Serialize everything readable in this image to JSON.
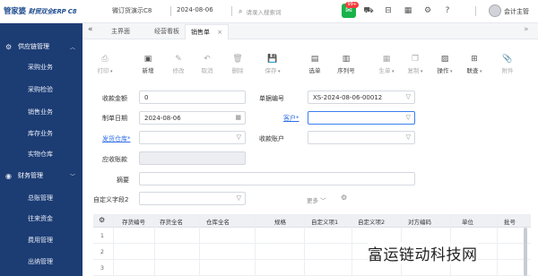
{
  "brand": {
    "name": "管家婆",
    "product": "财贸双全ERP C8"
  },
  "topbar": {
    "company": "微订货演示C8",
    "date": "2024-08-06",
    "search_placeholder": "请录入搜索词",
    "message_badge": "99+",
    "user": "会计主管"
  },
  "sidebar": {
    "groups": [
      {
        "label": "供应链管理",
        "icon": "chain-icon",
        "collapse": "︿"
      },
      {
        "label": "财务管理",
        "icon": "coin-icon",
        "collapse": "﹀"
      }
    ],
    "supply_items": [
      "采购业务",
      "采购检验",
      "销售业务",
      "库存业务",
      "实物仓库"
    ],
    "finance_items": [
      "总账管理",
      "往来资金",
      "费用管理",
      "出纳管理"
    ]
  },
  "tabs": {
    "collapse": "«",
    "items": [
      "主界面",
      "经营看板",
      "销售单"
    ],
    "close": "×",
    "expand": "»"
  },
  "toolbar": {
    "buttons": [
      {
        "label": "打印",
        "icon": "printer-icon",
        "glyph": "⎙",
        "disabled": true,
        "dropdown": true
      },
      {
        "label": "新增",
        "icon": "new-icon",
        "glyph": "▣",
        "disabled": false
      },
      {
        "label": "修改",
        "icon": "edit-icon",
        "glyph": "✎",
        "disabled": true
      },
      {
        "label": "取消",
        "icon": "undo-icon",
        "glyph": "↶",
        "disabled": true
      },
      {
        "label": "删除",
        "icon": "trash-icon",
        "glyph": "🗑",
        "disabled": true
      },
      {
        "label": "保存",
        "icon": "save-icon",
        "glyph": "💾",
        "disabled": true,
        "dropdown": true
      },
      {
        "label": "选单",
        "icon": "select-bill-icon",
        "glyph": "▤",
        "disabled": false
      },
      {
        "label": "序列号",
        "icon": "serial-icon",
        "glyph": "▥",
        "disabled": false
      },
      {
        "label": "生单",
        "icon": "generate-icon",
        "glyph": "▦",
        "disabled": true,
        "dropdown": true
      },
      {
        "label": "复制",
        "icon": "copy-icon",
        "glyph": "❐",
        "disabled": true,
        "dropdown": true
      },
      {
        "label": "操作",
        "icon": "operation-icon",
        "glyph": "▨",
        "disabled": false,
        "dropdown": true
      },
      {
        "label": "联查",
        "icon": "link-query-icon",
        "glyph": "⊞",
        "disabled": false,
        "dropdown": true
      },
      {
        "label": "附件",
        "icon": "attachment-icon",
        "glyph": "📎",
        "disabled": true
      }
    ]
  },
  "form": {
    "received_amount": {
      "label": "收款金额",
      "value": "0"
    },
    "bill_no": {
      "label": "单据编号",
      "value": "XS-2024-08-06-00012"
    },
    "bill_date": {
      "label": "制单日期",
      "value": "2024-08-06"
    },
    "customer": {
      "label": "客户*",
      "value": ""
    },
    "ship_warehouse": {
      "label": "发货仓库*",
      "value": ""
    },
    "receive_account": {
      "label": "收款账户",
      "value": ""
    },
    "receivable": {
      "label": "应收账款",
      "value": ""
    },
    "summary": {
      "label": "摘要",
      "value": ""
    },
    "custom_field2": {
      "label": "自定义字段2",
      "value": ""
    },
    "more": "更多 ﹀"
  },
  "grid": {
    "columns": [
      "存货编号",
      "存货全名",
      "仓库全名",
      "规格",
      "自定义项1",
      "自定义项2",
      "对方编码",
      "单位",
      "批号"
    ],
    "rows": [
      "1",
      "2",
      "3"
    ]
  },
  "watermark": "富运链动科技网"
}
